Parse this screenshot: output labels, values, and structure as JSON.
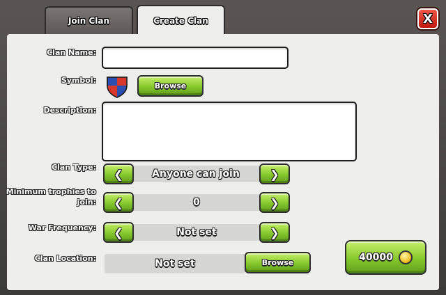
{
  "tabs": {
    "join": "Join Clan",
    "create": "Create Clan"
  },
  "close": {
    "label": "X"
  },
  "form": {
    "clan_name_label": "Clan Name:",
    "clan_name_value": "",
    "symbol_label": "Symbol:",
    "symbol_browse": "Browse",
    "description_label": "Description:",
    "description_value": "",
    "clan_type_label": "Clan Type:",
    "clan_type_value": "Anyone can join",
    "min_trophies_label_1": "Minimum trophies to",
    "min_trophies_label_2": "join:",
    "min_trophies_value": "0",
    "war_frequency_label": "War Frequency:",
    "war_frequency_value": "Not set",
    "location_label": "Clan Location:",
    "location_value": "Not set",
    "location_browse": "Browse",
    "prev_arrow": "❮",
    "next_arrow": "❯"
  },
  "cost": {
    "amount": "40000",
    "currency_icon": "gold-coin-icon"
  },
  "colors": {
    "button_green": "#85c82c",
    "close_red": "#d8271b",
    "panel": "#eeeeec"
  }
}
